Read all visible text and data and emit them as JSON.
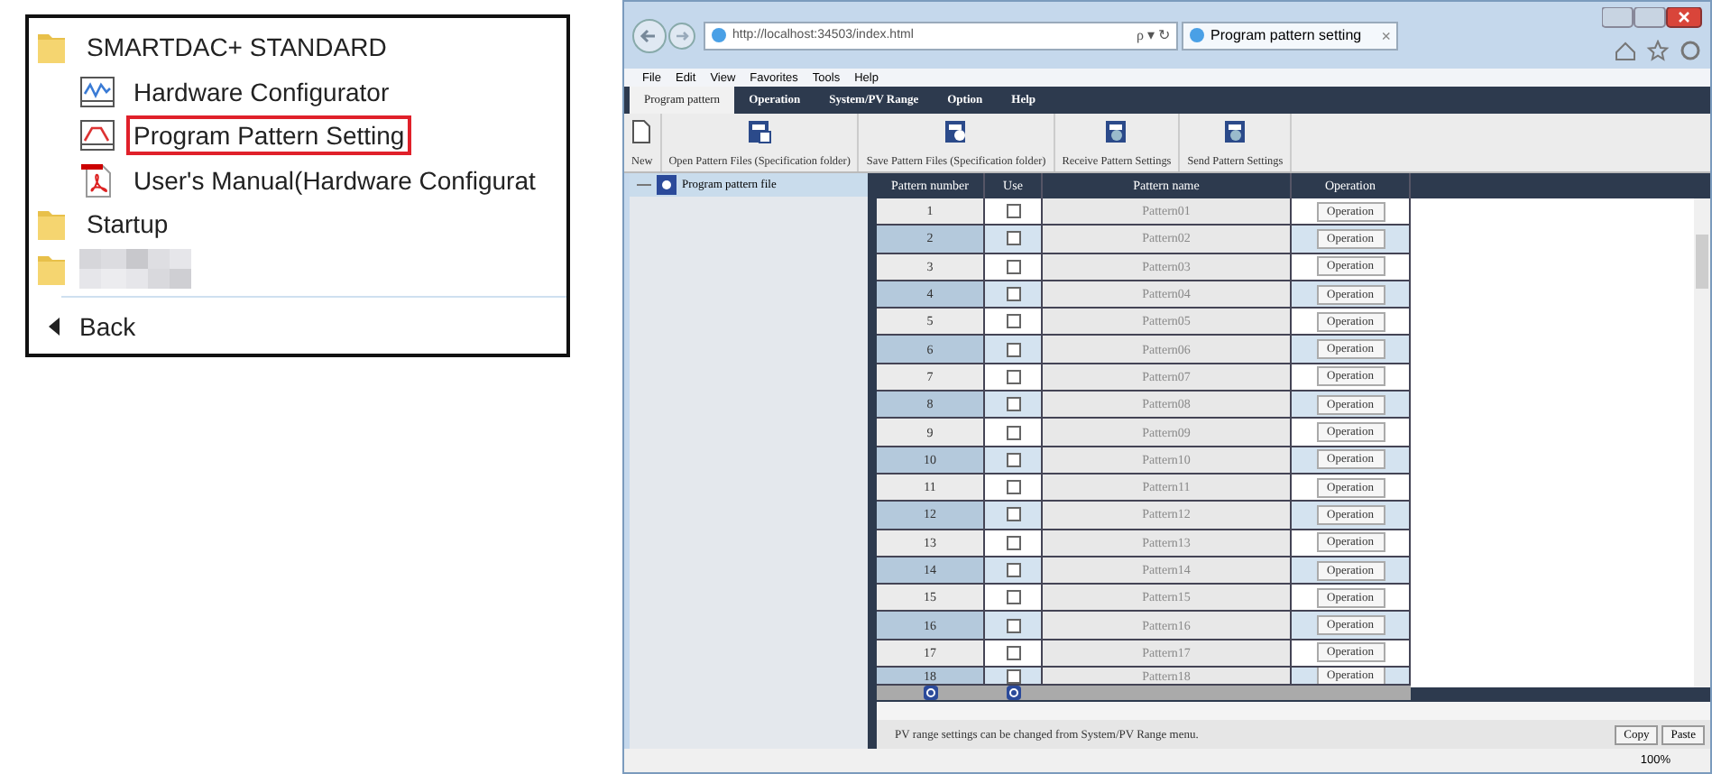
{
  "start_menu": {
    "items": [
      {
        "kind": "folder",
        "label": "SMARTDAC+ STANDARD",
        "highlighted": false
      },
      {
        "kind": "chart-app",
        "label": "Hardware Configurator",
        "highlighted": false
      },
      {
        "kind": "pattern-app",
        "label": "Program Pattern Setting",
        "highlighted": true
      },
      {
        "kind": "pdf",
        "label": "User's Manual(Hardware Configurat",
        "highlighted": false
      },
      {
        "kind": "folder",
        "label": "Startup",
        "highlighted": false
      },
      {
        "kind": "redacted-folder"
      }
    ],
    "back": "Back"
  },
  "browser": {
    "address": "http://localhost:34503/index.html",
    "search_glyph": "ρ ▾ ↻",
    "tab_title": "Program pattern setting",
    "tab_close": "×",
    "menu": [
      "File",
      "Edit",
      "View",
      "Favorites",
      "Tools",
      "Help"
    ],
    "nav_tabs": [
      {
        "label": "Program pattern",
        "selected": true
      },
      {
        "label": "Operation",
        "selected": false
      },
      {
        "label": "System/PV Range",
        "selected": false
      },
      {
        "label": "Option",
        "selected": false
      },
      {
        "label": "Help",
        "selected": false
      }
    ],
    "toolbar": [
      {
        "kind": "new",
        "label": "New"
      },
      {
        "kind": "open",
        "label": "Open Pattern Files (Specification folder)"
      },
      {
        "kind": "save",
        "label": "Save Pattern Files (Specification folder)"
      },
      {
        "kind": "receive",
        "label": "Receive Pattern Settings"
      },
      {
        "kind": "send",
        "label": "Send Pattern Settings"
      }
    ],
    "tree": {
      "label": "Program pattern file",
      "selected": true
    },
    "table": {
      "columns": [
        "Pattern number",
        "Use",
        "Pattern name",
        "Operation"
      ],
      "rows": [
        {
          "number": "1",
          "use": false,
          "name": "Pattern01",
          "action": "Operation"
        },
        {
          "number": "2",
          "use": false,
          "name": "Pattern02",
          "action": "Operation"
        },
        {
          "number": "3",
          "use": false,
          "name": "Pattern03",
          "action": "Operation"
        },
        {
          "number": "4",
          "use": false,
          "name": "Pattern04",
          "action": "Operation"
        },
        {
          "number": "5",
          "use": false,
          "name": "Pattern05",
          "action": "Operation"
        },
        {
          "number": "6",
          "use": false,
          "name": "Pattern06",
          "action": "Operation"
        },
        {
          "number": "7",
          "use": false,
          "name": "Pattern07",
          "action": "Operation"
        },
        {
          "number": "8",
          "use": false,
          "name": "Pattern08",
          "action": "Operation"
        },
        {
          "number": "9",
          "use": false,
          "name": "Pattern09",
          "action": "Operation"
        },
        {
          "number": "10",
          "use": false,
          "name": "Pattern10",
          "action": "Operation"
        },
        {
          "number": "11",
          "use": false,
          "name": "Pattern11",
          "action": "Operation"
        },
        {
          "number": "12",
          "use": false,
          "name": "Pattern12",
          "action": "Operation"
        },
        {
          "number": "13",
          "use": false,
          "name": "Pattern13",
          "action": "Operation"
        },
        {
          "number": "14",
          "use": false,
          "name": "Pattern14",
          "action": "Operation"
        },
        {
          "number": "15",
          "use": false,
          "name": "Pattern15",
          "action": "Operation"
        },
        {
          "number": "16",
          "use": false,
          "name": "Pattern16",
          "action": "Operation"
        },
        {
          "number": "17",
          "use": false,
          "name": "Pattern17",
          "action": "Operation"
        },
        {
          "number": "18",
          "use": false,
          "name": "Pattern18",
          "action": "Operation"
        }
      ]
    },
    "message": "PV range settings can be changed from System/PV Range menu.",
    "buttons": [
      "Copy",
      "Paste"
    ],
    "zoom": "100%"
  }
}
